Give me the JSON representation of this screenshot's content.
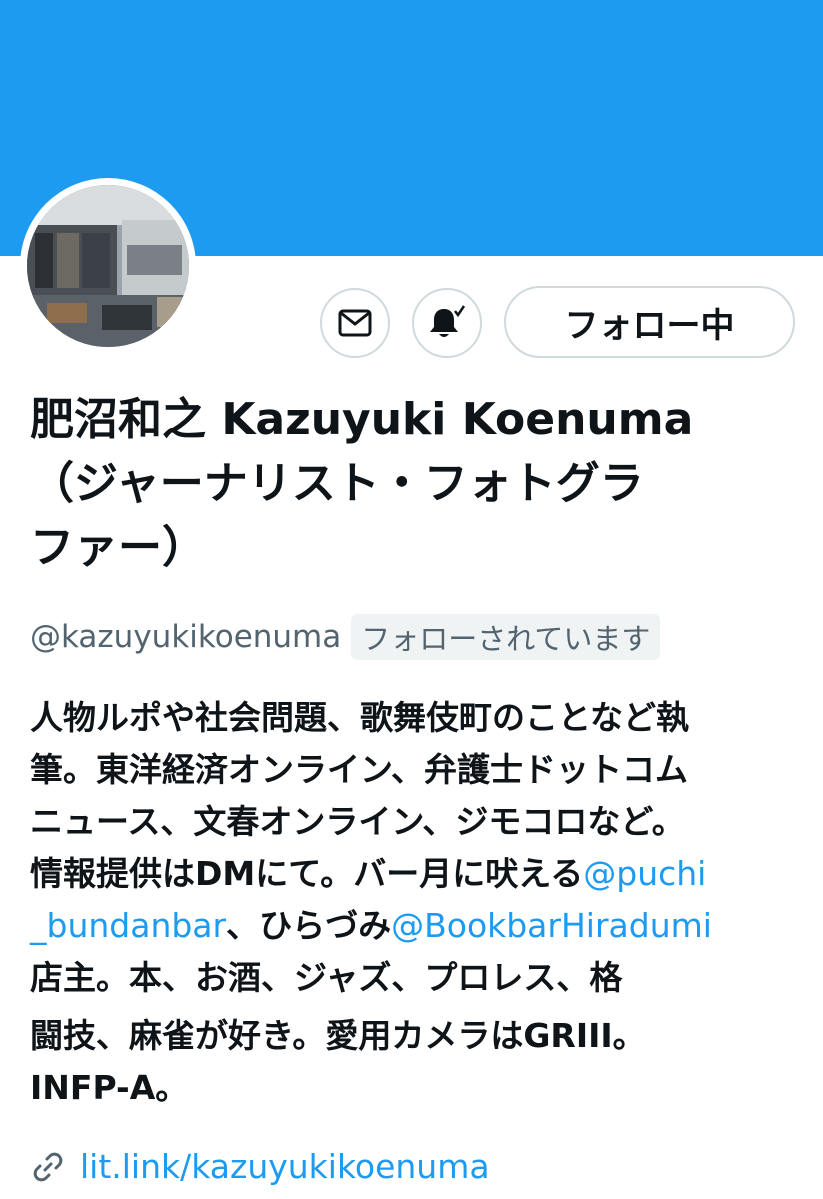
{
  "profile": {
    "name_lines": [
      "肥沼和之 Kazuyuki Koenuma",
      "（ジャーナリスト・フォトグラ",
      "ファー）"
    ],
    "handle": "@kazuyukikoenuma",
    "follows_you_badge": "フォローされています",
    "follow_button_label": "フォロー中",
    "bio": {
      "line1": "人物ルポや社会問題、歌舞伎町のことなど執",
      "line2": "筆。東洋経済オンライン、弁護士ドットコム",
      "line3": "ニュース、文春オンライン、ジモコロなど。",
      "line4_text": "情報提供はDMにて。バー月に吠える",
      "line4_mention": "@puchi",
      "line5_mention": "_bundanbar",
      "line5_text": "、ひらづみ",
      "line5_mention2": "@BookbarHiradumi",
      "line6": "店主。本、お酒、ジャズ、プロレス、格",
      "line7": "闘技、麻雀が好き。愛用カメラはGRIII。",
      "line8": "INFP-A。"
    },
    "link": "lit.link/kazuyukikoenuma"
  },
  "icons": {
    "message": "envelope-icon",
    "notify": "bell-check-icon",
    "link": "link-icon"
  },
  "colors": {
    "banner": "#1d9bf0",
    "accent": "#1d9bf0",
    "text": "#0f1419",
    "secondary": "#536471",
    "border": "#cfd9de"
  }
}
